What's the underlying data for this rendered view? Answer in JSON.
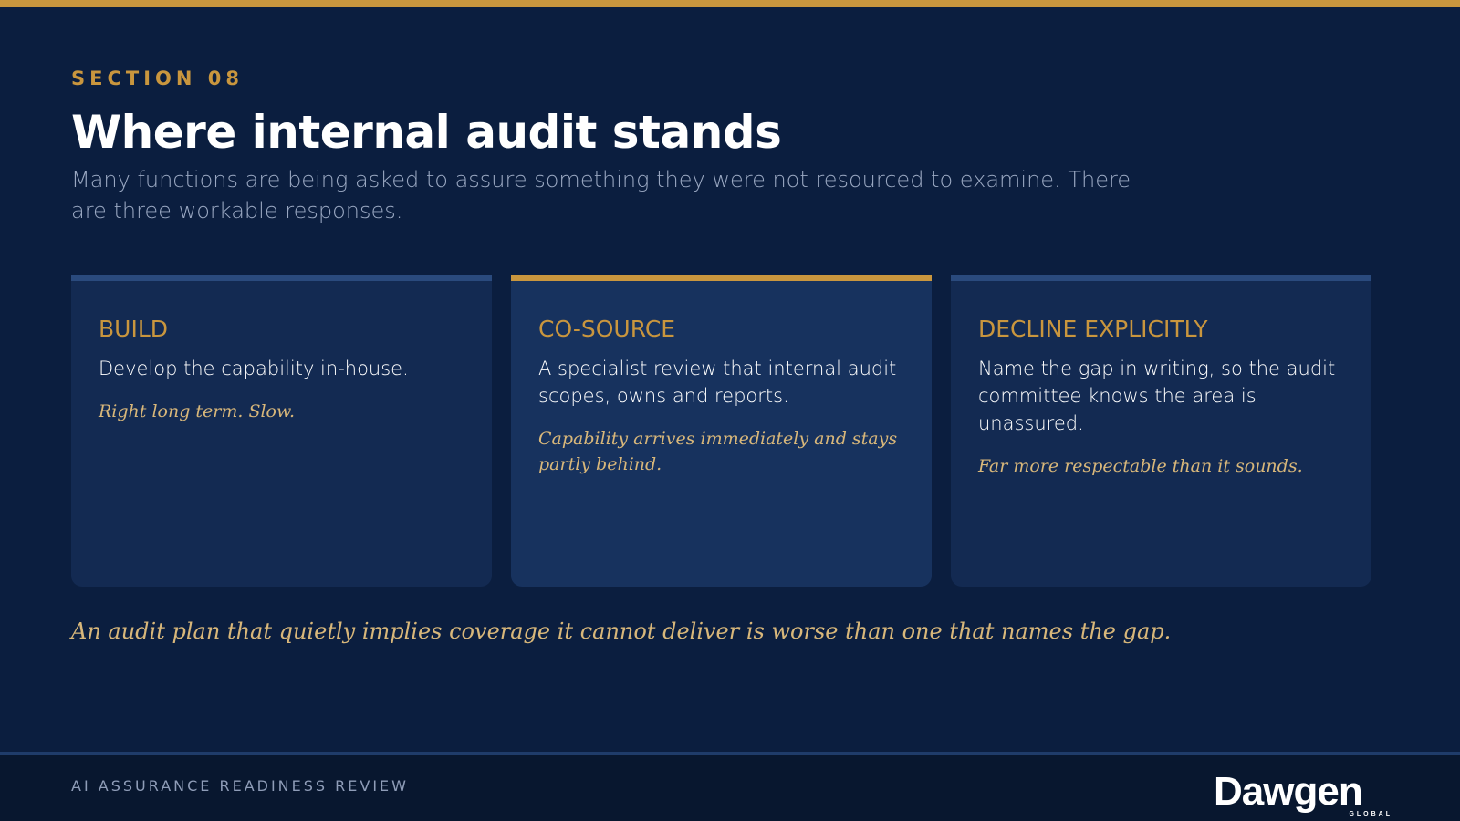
{
  "section": {
    "label": "SECTION 08"
  },
  "header": {
    "title": "Where internal audit stands",
    "subtitle": "Many functions are being asked to assure something they were not resourced to examine. There are three workable responses."
  },
  "cards": [
    {
      "title": "BUILD",
      "description": "Develop the capability in-house.",
      "note": "Right long term. Slow."
    },
    {
      "title": "CO-SOURCE",
      "description": "A specialist review that internal audit scopes, owns and reports.",
      "note": "Capability arrives immediately and stays partly behind."
    },
    {
      "title": "DECLINE EXPLICITLY",
      "description": "Name the gap in writing, so the audit committee knows the area is unassured.",
      "note": "Far more respectable than it sounds."
    }
  ],
  "closing": {
    "note": "An audit plan that quietly implies coverage it cannot deliver is worse than one that names the gap."
  },
  "footer": {
    "label": "AI ASSURANCE READINESS REVIEW",
    "logo_text": "Dawgen",
    "logo_subtext": "GLOBAL"
  },
  "colors": {
    "background": "#0b1e3f",
    "accent": "#c9963e",
    "card": "#132a52",
    "card_highlight": "#17325e"
  }
}
